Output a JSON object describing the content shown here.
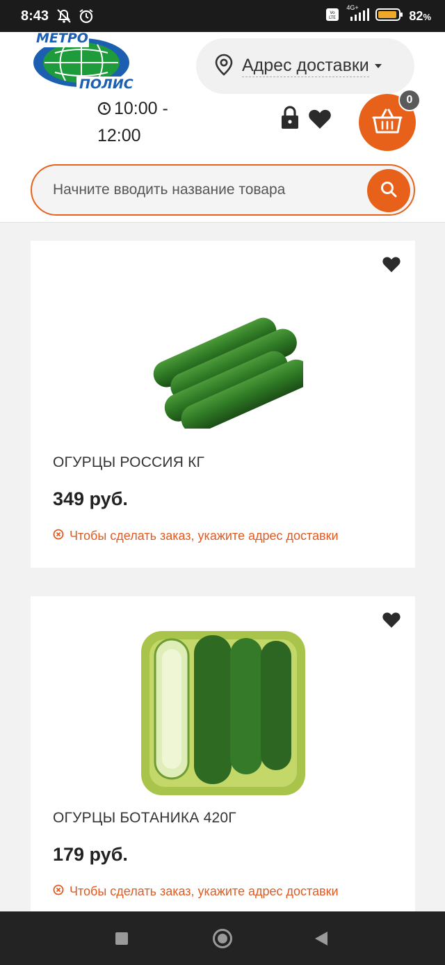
{
  "status_bar": {
    "time": "8:43",
    "battery_percent": "82",
    "battery_suffix": "%",
    "network": "4G+",
    "icons": [
      "mute-alarm-icon",
      "alarm-clock-icon",
      "volte-icon",
      "signal-icon",
      "battery-icon"
    ]
  },
  "header": {
    "logo_text_top": "МЕТРО",
    "logo_text_bottom": "ПОЛИС",
    "address_label": "Адрес доставки",
    "delivery_time_line1": "10:00 -",
    "delivery_time_line2": "12:00",
    "cart_count": "0",
    "accent_color": "#e8611a"
  },
  "search": {
    "placeholder": "Начните вводить название товара"
  },
  "products": [
    {
      "name": "ОГУРЦЫ РОССИЯ КГ",
      "price": "349 руб.",
      "warning": "Чтобы сделать заказ, укажите адрес доставки"
    },
    {
      "name": "ОГУРЦЫ БОТАНИКА 420Г",
      "price": "179 руб.",
      "warning": "Чтобы сделать заказ, укажите адрес доставки"
    }
  ]
}
